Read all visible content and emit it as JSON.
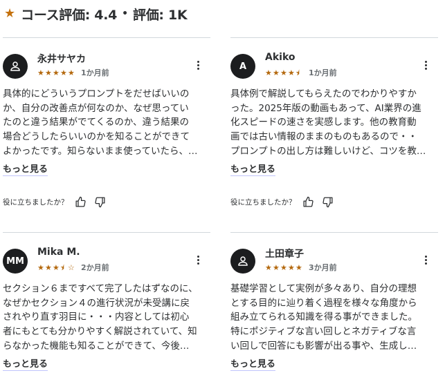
{
  "header": {
    "star_icon": "star-icon",
    "title": "コース評価: 4.4",
    "dot": "•",
    "rating_count": "評価: 1K"
  },
  "reviews": [
    {
      "name": "永井サヤカ",
      "avatar_initials": "",
      "avatar_icon": "user-icon",
      "rating": 5,
      "stars": [
        "★",
        "★",
        "★",
        "★",
        "★"
      ],
      "time": "1か月前",
      "body_lines": [
        "具体的にどういうプロンプトをだせばいいの",
        "か、自分の改善点が何なのか、なぜ思ってい",
        "たのと違う結果がでてくるのか、違う結果の",
        "場合どうしたらいいのかを知ることができて",
        "よかったです。知らないまま使っていたら、…"
      ],
      "more": "もっと見る",
      "helpful": "役に立ちましたか？"
    },
    {
      "name": "Akiko",
      "avatar_initials": "A",
      "avatar_icon": "",
      "rating": 4.5,
      "stars": [
        "★",
        "★",
        "★",
        "★",
        "⯨"
      ],
      "time": "1か月前",
      "body_lines": [
        "具体例で解説してもらえたのでわかりやすか",
        "った。2025年版の動画もあって、AI業界の進",
        "化スピードの速さを実感します。他の教育動",
        "画では古い情報のままのものもあるので・・",
        "プロンプトの出し方は難しいけど、コツを教…"
      ],
      "more": "もっと見る",
      "helpful": "役に立ちましたか？"
    },
    {
      "name": "Mika M.",
      "avatar_initials": "MM",
      "avatar_icon": "",
      "rating": 3.5,
      "stars": [
        "★",
        "★",
        "★",
        "⯨",
        "☆"
      ],
      "time": "2か月前",
      "body_lines": [
        "セクション６まですべて完了したはずなのに、",
        "なぜかセクション４の進行状況が未受講に戻",
        "されやり直す羽目に・・・内容としては初心",
        "者にもとても分かりやすく解説されていて、知",
        "らなかった機能も知ることができて、今後…"
      ],
      "more": "もっと見る",
      "helpful": ""
    },
    {
      "name": "土田章子",
      "avatar_initials": "",
      "avatar_icon": "user-icon",
      "rating": 5,
      "stars": [
        "★",
        "★",
        "★",
        "★",
        "★"
      ],
      "time": "3か月前",
      "body_lines": [
        "基礎学習として実例が多々あり、自分の理想",
        "とする目的に辿り着く過程を様々な角度から",
        "組み立てられる知識を得る事ができました。",
        "特にポジティブな言い回しとネガティブな言",
        "い回しで回答にも影響が出る事や、生成し…"
      ],
      "more": "もっと見る",
      "helpful": ""
    }
  ]
}
